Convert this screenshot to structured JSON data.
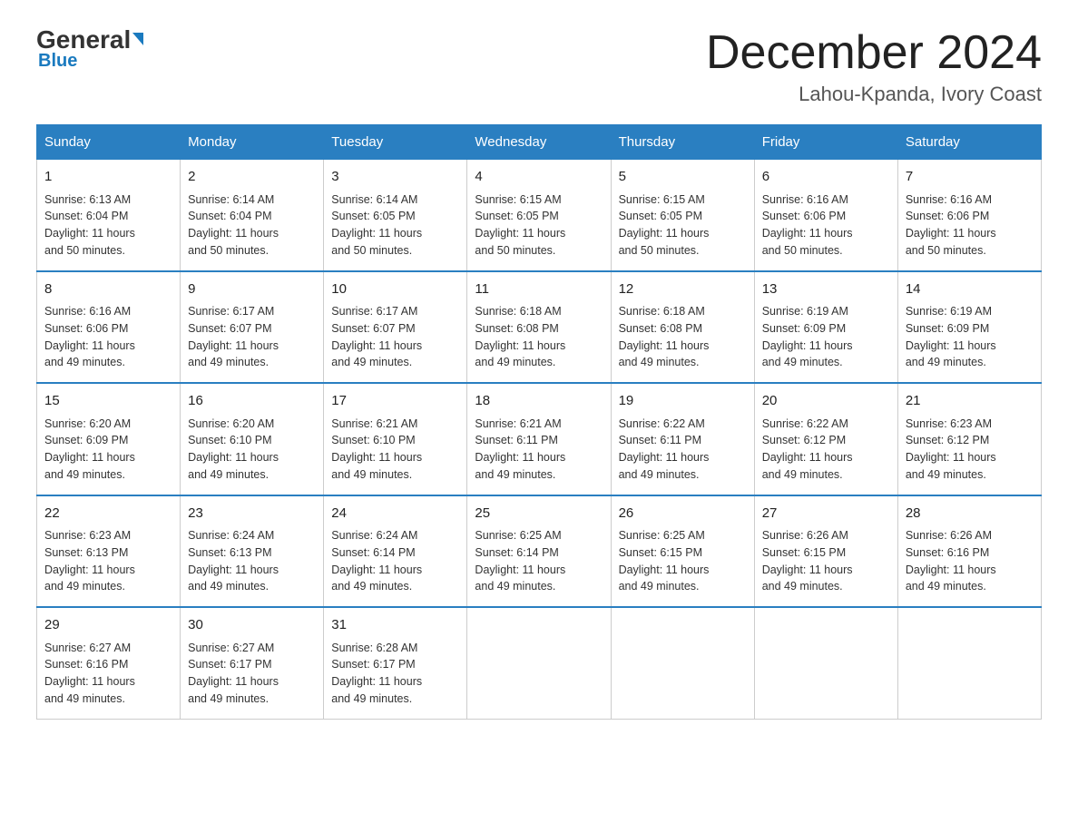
{
  "logo": {
    "name": "General",
    "name2": "Blue"
  },
  "header": {
    "month": "December 2024",
    "location": "Lahou-Kpanda, Ivory Coast"
  },
  "days_of_week": [
    "Sunday",
    "Monday",
    "Tuesday",
    "Wednesday",
    "Thursday",
    "Friday",
    "Saturday"
  ],
  "weeks": [
    [
      {
        "day": "1",
        "sunrise": "6:13 AM",
        "sunset": "6:04 PM",
        "daylight": "11 hours and 50 minutes."
      },
      {
        "day": "2",
        "sunrise": "6:14 AM",
        "sunset": "6:04 PM",
        "daylight": "11 hours and 50 minutes."
      },
      {
        "day": "3",
        "sunrise": "6:14 AM",
        "sunset": "6:05 PM",
        "daylight": "11 hours and 50 minutes."
      },
      {
        "day": "4",
        "sunrise": "6:15 AM",
        "sunset": "6:05 PM",
        "daylight": "11 hours and 50 minutes."
      },
      {
        "day": "5",
        "sunrise": "6:15 AM",
        "sunset": "6:05 PM",
        "daylight": "11 hours and 50 minutes."
      },
      {
        "day": "6",
        "sunrise": "6:16 AM",
        "sunset": "6:06 PM",
        "daylight": "11 hours and 50 minutes."
      },
      {
        "day": "7",
        "sunrise": "6:16 AM",
        "sunset": "6:06 PM",
        "daylight": "11 hours and 50 minutes."
      }
    ],
    [
      {
        "day": "8",
        "sunrise": "6:16 AM",
        "sunset": "6:06 PM",
        "daylight": "11 hours and 49 minutes."
      },
      {
        "day": "9",
        "sunrise": "6:17 AM",
        "sunset": "6:07 PM",
        "daylight": "11 hours and 49 minutes."
      },
      {
        "day": "10",
        "sunrise": "6:17 AM",
        "sunset": "6:07 PM",
        "daylight": "11 hours and 49 minutes."
      },
      {
        "day": "11",
        "sunrise": "6:18 AM",
        "sunset": "6:08 PM",
        "daylight": "11 hours and 49 minutes."
      },
      {
        "day": "12",
        "sunrise": "6:18 AM",
        "sunset": "6:08 PM",
        "daylight": "11 hours and 49 minutes."
      },
      {
        "day": "13",
        "sunrise": "6:19 AM",
        "sunset": "6:09 PM",
        "daylight": "11 hours and 49 minutes."
      },
      {
        "day": "14",
        "sunrise": "6:19 AM",
        "sunset": "6:09 PM",
        "daylight": "11 hours and 49 minutes."
      }
    ],
    [
      {
        "day": "15",
        "sunrise": "6:20 AM",
        "sunset": "6:09 PM",
        "daylight": "11 hours and 49 minutes."
      },
      {
        "day": "16",
        "sunrise": "6:20 AM",
        "sunset": "6:10 PM",
        "daylight": "11 hours and 49 minutes."
      },
      {
        "day": "17",
        "sunrise": "6:21 AM",
        "sunset": "6:10 PM",
        "daylight": "11 hours and 49 minutes."
      },
      {
        "day": "18",
        "sunrise": "6:21 AM",
        "sunset": "6:11 PM",
        "daylight": "11 hours and 49 minutes."
      },
      {
        "day": "19",
        "sunrise": "6:22 AM",
        "sunset": "6:11 PM",
        "daylight": "11 hours and 49 minutes."
      },
      {
        "day": "20",
        "sunrise": "6:22 AM",
        "sunset": "6:12 PM",
        "daylight": "11 hours and 49 minutes."
      },
      {
        "day": "21",
        "sunrise": "6:23 AM",
        "sunset": "6:12 PM",
        "daylight": "11 hours and 49 minutes."
      }
    ],
    [
      {
        "day": "22",
        "sunrise": "6:23 AM",
        "sunset": "6:13 PM",
        "daylight": "11 hours and 49 minutes."
      },
      {
        "day": "23",
        "sunrise": "6:24 AM",
        "sunset": "6:13 PM",
        "daylight": "11 hours and 49 minutes."
      },
      {
        "day": "24",
        "sunrise": "6:24 AM",
        "sunset": "6:14 PM",
        "daylight": "11 hours and 49 minutes."
      },
      {
        "day": "25",
        "sunrise": "6:25 AM",
        "sunset": "6:14 PM",
        "daylight": "11 hours and 49 minutes."
      },
      {
        "day": "26",
        "sunrise": "6:25 AM",
        "sunset": "6:15 PM",
        "daylight": "11 hours and 49 minutes."
      },
      {
        "day": "27",
        "sunrise": "6:26 AM",
        "sunset": "6:15 PM",
        "daylight": "11 hours and 49 minutes."
      },
      {
        "day": "28",
        "sunrise": "6:26 AM",
        "sunset": "6:16 PM",
        "daylight": "11 hours and 49 minutes."
      }
    ],
    [
      {
        "day": "29",
        "sunrise": "6:27 AM",
        "sunset": "6:16 PM",
        "daylight": "11 hours and 49 minutes."
      },
      {
        "day": "30",
        "sunrise": "6:27 AM",
        "sunset": "6:17 PM",
        "daylight": "11 hours and 49 minutes."
      },
      {
        "day": "31",
        "sunrise": "6:28 AM",
        "sunset": "6:17 PM",
        "daylight": "11 hours and 49 minutes."
      },
      null,
      null,
      null,
      null
    ]
  ],
  "labels": {
    "sunrise": "Sunrise:",
    "sunset": "Sunset:",
    "daylight": "Daylight:"
  }
}
